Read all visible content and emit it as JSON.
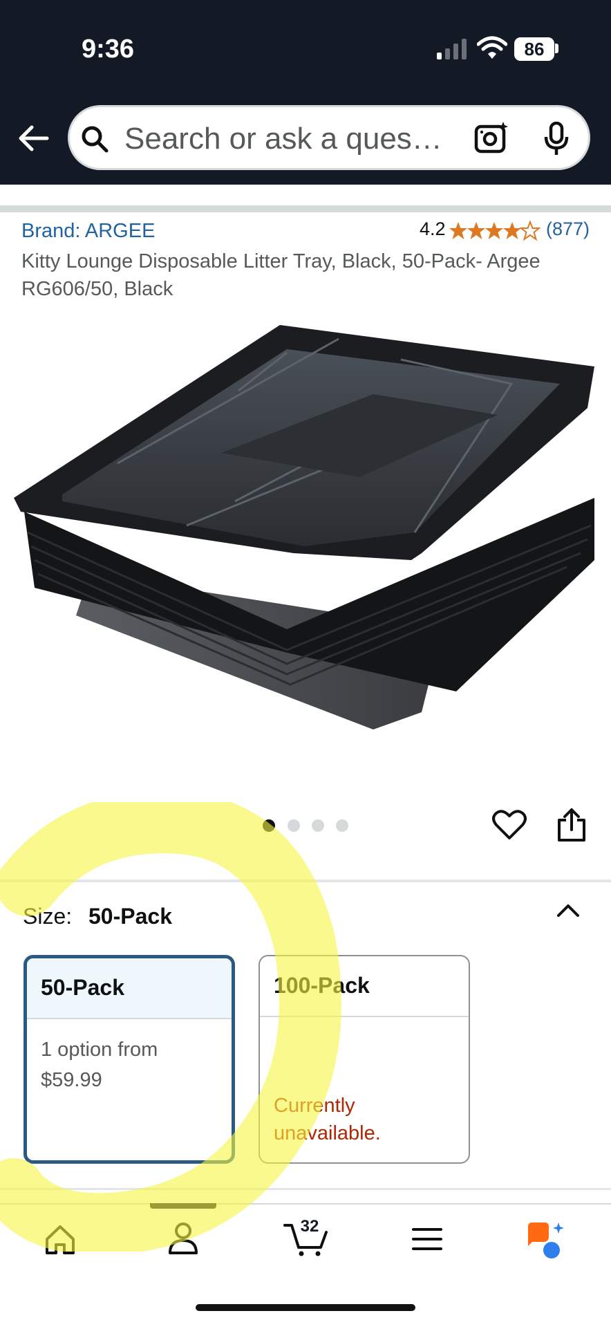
{
  "status_bar": {
    "time": "9:36",
    "battery": "86"
  },
  "search": {
    "placeholder": "Search or ask a ques…"
  },
  "product": {
    "brand": "Brand: ARGEE",
    "rating": "4.2",
    "stars": 4.2,
    "review_count": "(877)",
    "title": "Kitty Lounge Disposable Litter Tray, Black, 50-Pack- Argee RG606/50, Black",
    "image_index": 1,
    "image_total": 4
  },
  "size": {
    "label": "Size:",
    "selected": "50-Pack",
    "options": [
      {
        "name": "50-Pack",
        "line1": "1 option from",
        "line2": "$59.99"
      },
      {
        "name": "100-Pack",
        "status": "Currently unavailable."
      }
    ]
  },
  "bottom_nav": {
    "cart_count": "32"
  },
  "colors": {
    "header_bg": "#131a26",
    "link": "#2162a1",
    "star": "#de7921",
    "unavailable": "#b12704",
    "selected_border": "#2a5a82",
    "highlighter": "#f5f542"
  }
}
